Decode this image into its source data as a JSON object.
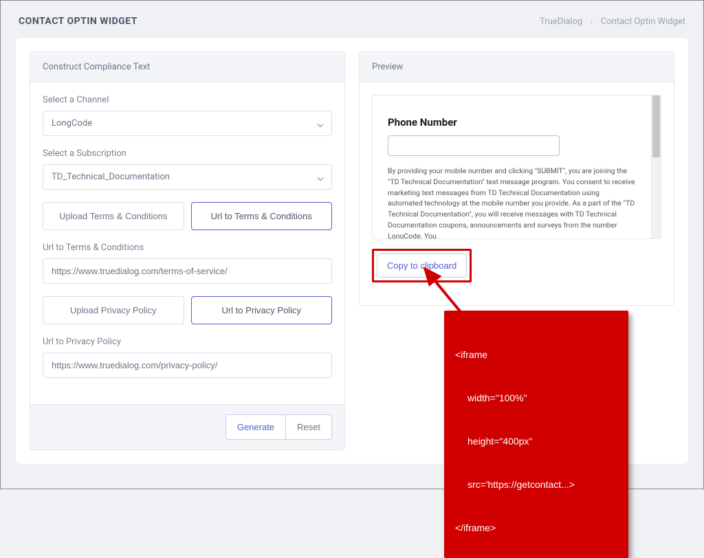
{
  "header": {
    "title": "CONTACT OPTIN WIDGET"
  },
  "breadcrumb": {
    "item1": "TrueDialog",
    "sep": "›",
    "item2": "Contact Optin Widget"
  },
  "form": {
    "panel_title": "Construct Compliance Text",
    "channel": {
      "label": "Select a Channel",
      "value": "LongCode"
    },
    "subscription": {
      "label": "Select a Subscription",
      "value": "TD_Technical_Documentation"
    },
    "terms": {
      "upload_label": "Upload Terms & Conditions",
      "url_btn_label": "Url to Terms & Conditions",
      "url_label": "Url to Terms & Conditions",
      "url_value": "https://www.truedialog.com/terms-of-service/"
    },
    "privacy": {
      "upload_label": "Upload Privacy Policy",
      "url_btn_label": "Url to Privacy Policy",
      "url_label": "Url to Privacy Policy",
      "url_value": "https://www.truedialog.com/privacy-policy/"
    },
    "footer": {
      "generate": "Generate",
      "reset": "Reset"
    }
  },
  "preview": {
    "panel_title": "Preview",
    "phone_label": "Phone Number",
    "compliance_text": "By providing your mobile number and clicking \"SUBMIT\", you are joining the \"TD Technical Documentation\" text message program. You consent to receive marketing text messages from TD Technical Documentation using automated technology at the mobile number you provide. As a part of the \"TD Technical Documentation\", you will receive messages with TD Technical Documentation coupons, announcements and surveys from the number LongCode. You",
    "copy_label": "Copy to clipboard"
  },
  "annotation": {
    "line1": "<iframe",
    "line2": "width=\"100%\"",
    "line3": "height=\"400px\"",
    "line4": "src='https://getcontact...>",
    "line5": "</iframe>"
  }
}
